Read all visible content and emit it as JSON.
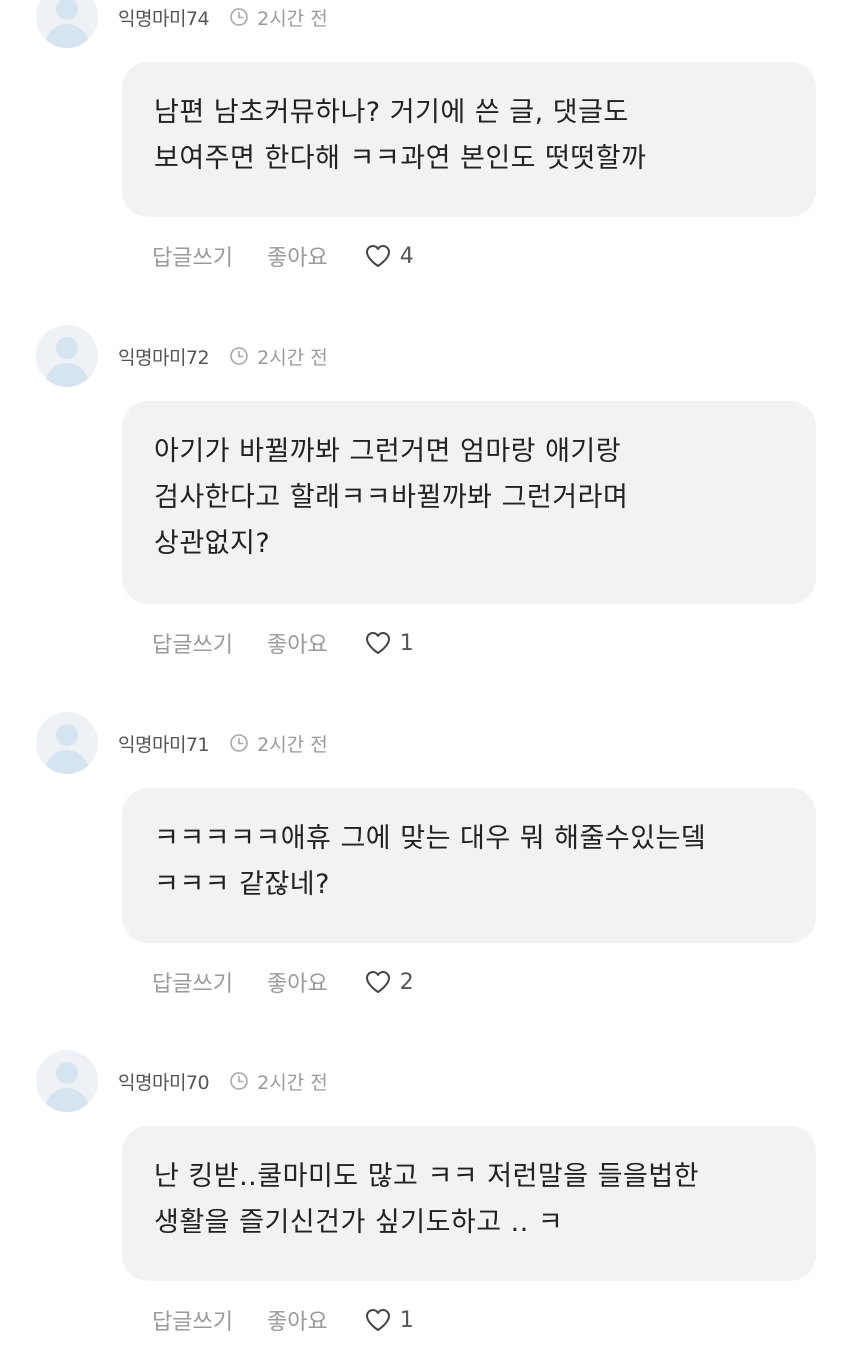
{
  "actions": {
    "reply_label": "답글쓰기",
    "like_label": "좋아요"
  },
  "comments": [
    {
      "author": "익명마미74",
      "time": "2시간 전",
      "lines": [
        "남편 남초커뮤하나? 거기에 쓴 글, 댓글도",
        "보여주면 한다해 ㅋㅋ과연 본인도 떳떳할까"
      ],
      "likes": "4"
    },
    {
      "author": "익명마미72",
      "time": "2시간 전",
      "lines": [
        "아기가 바뀔까봐 그런거면 엄마랑 애기랑",
        "검사한다고 할래ㅋㅋ바뀔까봐 그런거라며",
        "상관없지?"
      ],
      "likes": "1"
    },
    {
      "author": "익명마미71",
      "time": "2시간 전",
      "lines": [
        "ㅋㅋㅋㅋㅋ애휴 그에 맞는 대우 뭐 해줄수있는뎈",
        "ㅋㅋㅋ 같잖네?"
      ],
      "likes": "2"
    },
    {
      "author": "익명마미70",
      "time": "2시간 전",
      "lines": [
        "난 킹받..쿨마미도 많고 ㅋㅋ 저런말을 들을법한",
        "생활을 즐기신건가 싶기도하고 .. ㅋ"
      ],
      "likes": "1"
    }
  ],
  "colors": {
    "bubble_bg": "#f2f2f2",
    "muted_text": "#9a9a9a",
    "avatar_bg": "#eef2f6",
    "avatar_fg": "#d6e4ef"
  }
}
